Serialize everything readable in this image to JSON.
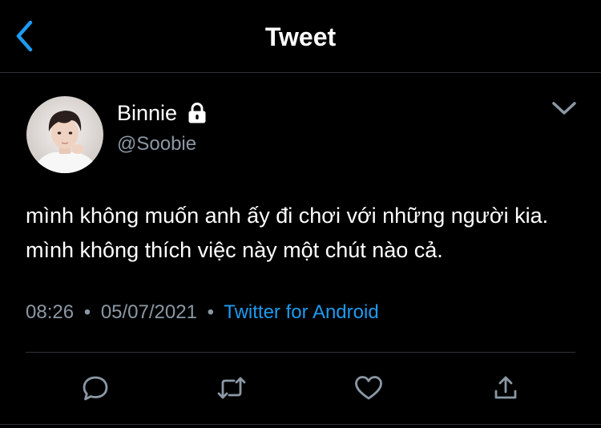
{
  "header": {
    "title": "Tweet",
    "back_icon": "chevron-left-icon"
  },
  "author": {
    "name": "Binnie",
    "handle": "@Soobie",
    "protected_icon": "lock-icon"
  },
  "tweet": {
    "text": "mình không muốn anh ấy đi chơi với những người kia. mình không thích việc này một chút nào cả.",
    "time": "08:26",
    "separator": "•",
    "date": "05/07/2021",
    "source": "Twitter for Android"
  },
  "actions": [
    {
      "icon": "reply-icon"
    },
    {
      "icon": "retweet-icon"
    },
    {
      "icon": "like-icon"
    },
    {
      "icon": "share-icon"
    }
  ],
  "colors": {
    "background": "#000000",
    "text": "#ffffff",
    "secondary_text": "#8b98a5",
    "accent": "#1d9bf0",
    "divider": "#2f3336"
  }
}
